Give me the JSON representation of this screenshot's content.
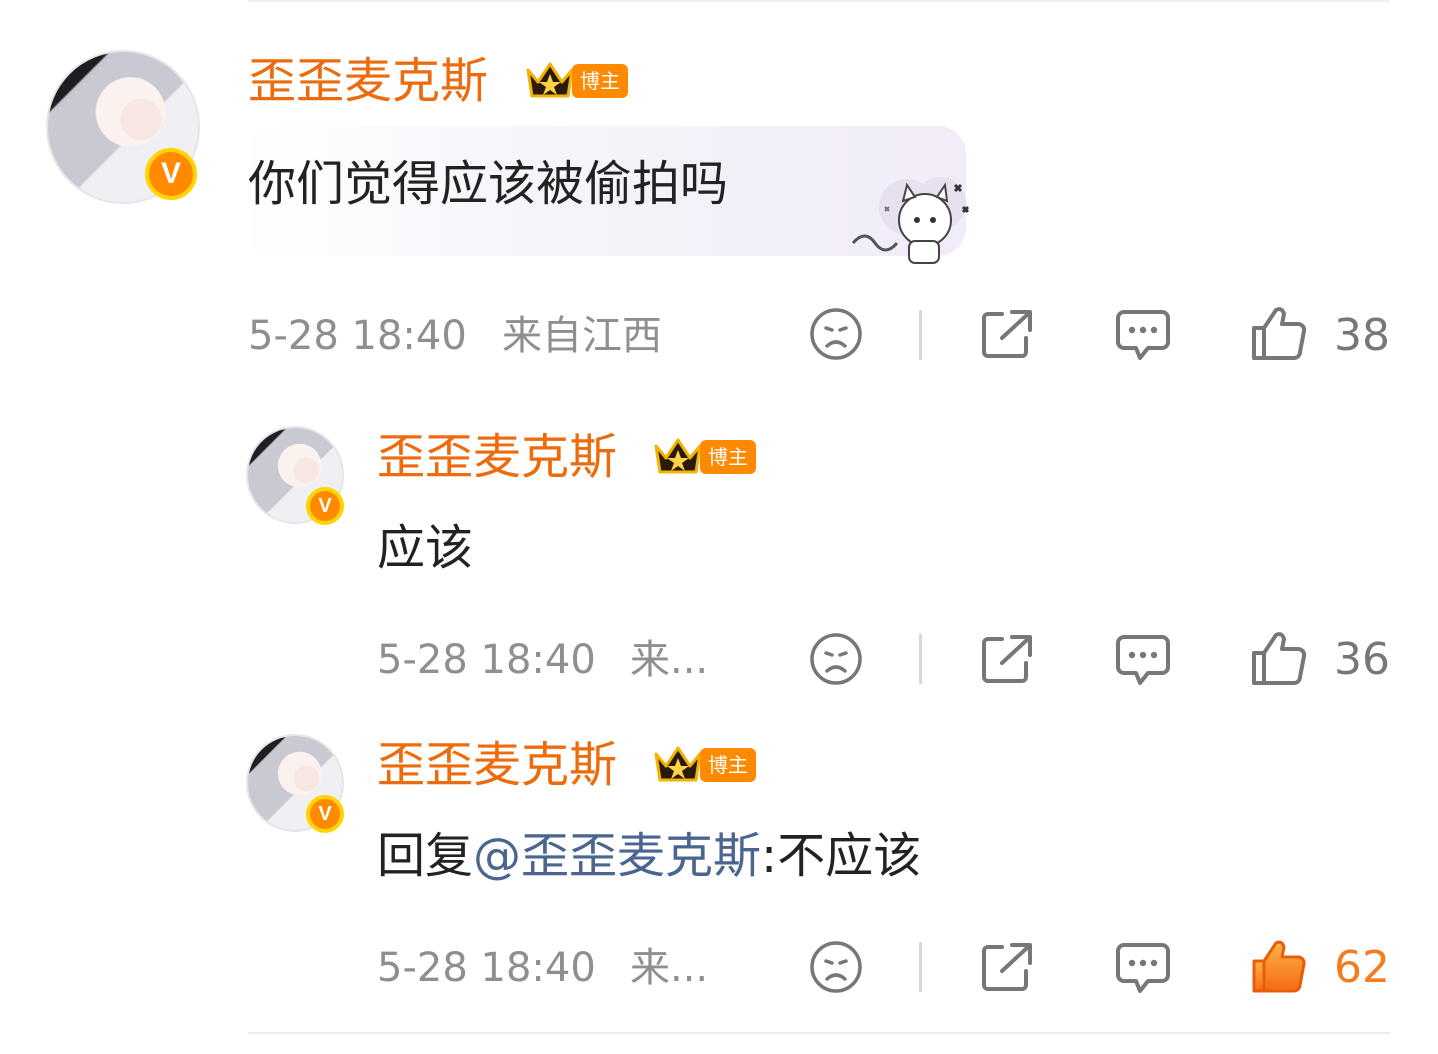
{
  "comments": [
    {
      "username": "歪歪麦克斯",
      "tag": "博主",
      "text": "你们觉得应该被偷拍吗",
      "time": "5-28 18:40",
      "location": "来自江西",
      "likes": "38",
      "liked": false
    },
    {
      "username": "歪歪麦克斯",
      "tag": "博主",
      "text": "应该",
      "time": "5-28 18:40",
      "location": "来...",
      "likes": "36",
      "liked": false
    },
    {
      "username": "歪歪麦克斯",
      "tag": "博主",
      "reply_prefix": "回复",
      "mention": "@歪歪麦克斯",
      "text": ":不应该",
      "time": "5-28 18:40",
      "location": "来...",
      "likes": "62",
      "liked": true
    }
  ],
  "icons": [
    "sad-face-icon",
    "share-icon",
    "comment-icon",
    "thumbs-up-icon",
    "crown-icon",
    "verified-v-icon"
  ],
  "colors": {
    "username": "#ee6b0c",
    "mention": "#4a6590",
    "meta": "#8f8f8f",
    "like_active": "#f57c1f",
    "tag_bg": "#ff8a00"
  }
}
